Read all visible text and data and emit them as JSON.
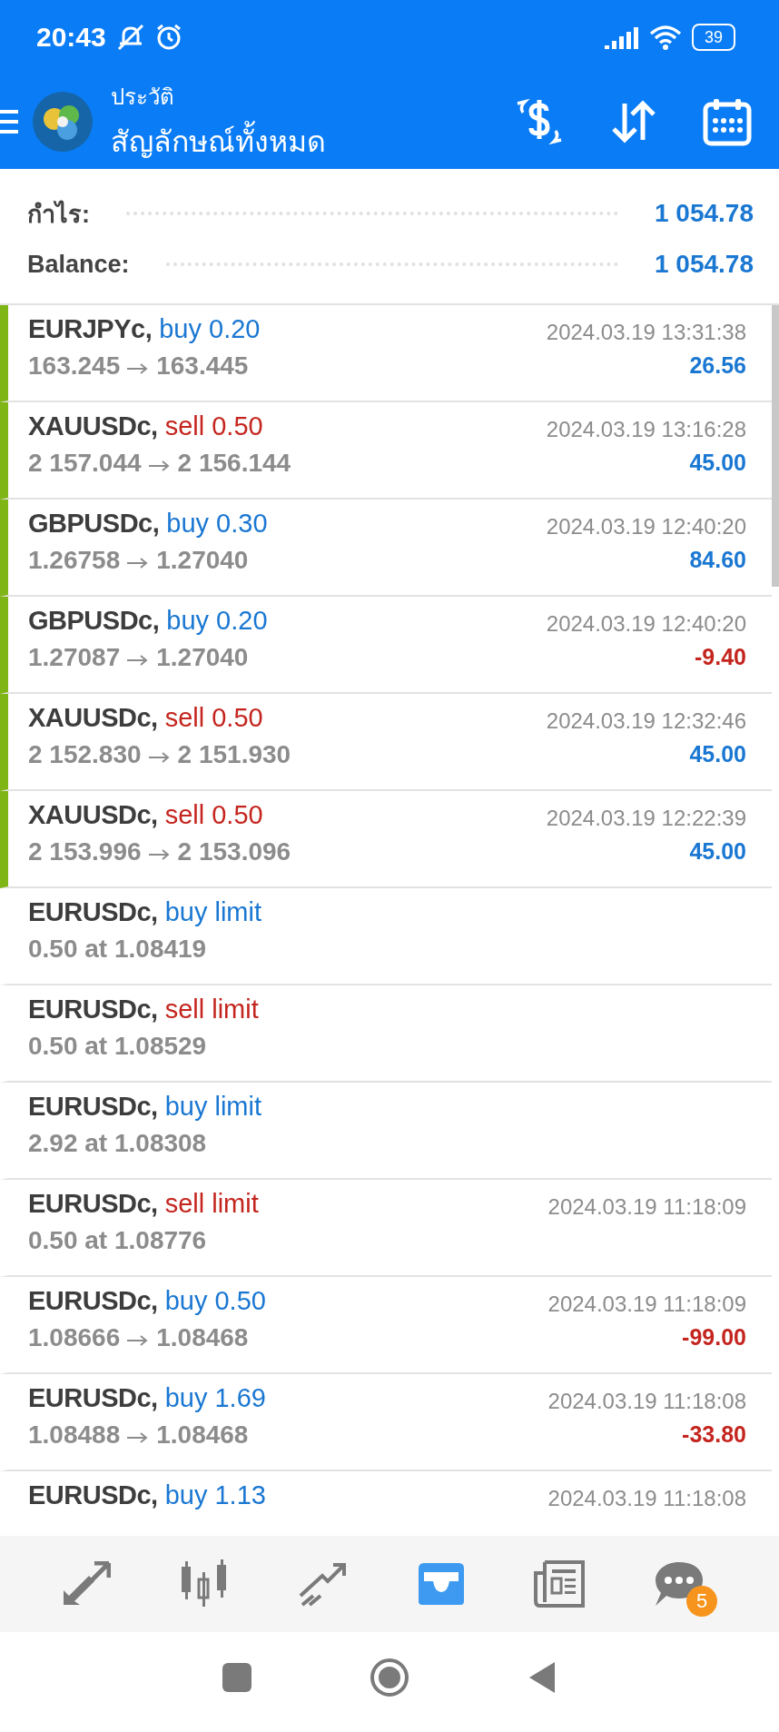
{
  "status_bar": {
    "time": "20:43",
    "battery": "39"
  },
  "header": {
    "subtitle": "ประวัติ",
    "title": "สัญลักษณ์ทั้งหมด"
  },
  "summary": [
    {
      "label": "กำไร:",
      "value": "1 054.78"
    },
    {
      "label": "Balance:",
      "value": "1 054.78"
    }
  ],
  "rows": [
    {
      "kind": "deal",
      "marked": true,
      "symbol": "EURJPYc,",
      "sell": false,
      "action": "buy 0.20",
      "detail_from": "163.245",
      "detail_to": "163.445",
      "time": "2024.03.19 13:31:38",
      "profit": "26.56",
      "loss": false
    },
    {
      "kind": "deal",
      "marked": true,
      "symbol": "XAUUSDc,",
      "sell": true,
      "action": "sell 0.50",
      "detail_from": "2 157.044",
      "detail_to": "2 156.144",
      "time": "2024.03.19 13:16:28",
      "profit": "45.00",
      "loss": false
    },
    {
      "kind": "deal",
      "marked": true,
      "symbol": "GBPUSDc,",
      "sell": false,
      "action": "buy 0.30",
      "detail_from": "1.26758",
      "detail_to": "1.27040",
      "time": "2024.03.19 12:40:20",
      "profit": "84.60",
      "loss": false
    },
    {
      "kind": "deal",
      "marked": true,
      "symbol": "GBPUSDc,",
      "sell": false,
      "action": "buy 0.20",
      "detail_from": "1.27087",
      "detail_to": "1.27040",
      "time": "2024.03.19 12:40:20",
      "profit": "-9.40",
      "loss": true
    },
    {
      "kind": "deal",
      "marked": true,
      "symbol": "XAUUSDc,",
      "sell": true,
      "action": "sell 0.50",
      "detail_from": "2 152.830",
      "detail_to": "2 151.930",
      "time": "2024.03.19 12:32:46",
      "profit": "45.00",
      "loss": false
    },
    {
      "kind": "deal",
      "marked": true,
      "symbol": "XAUUSDc,",
      "sell": true,
      "action": "sell 0.50",
      "detail_from": "2 153.996",
      "detail_to": "2 153.096",
      "time": "2024.03.19 12:22:39",
      "profit": "45.00",
      "loss": false
    },
    {
      "kind": "order",
      "marked": false,
      "symbol": "EURUSDc,",
      "sell": false,
      "action": "buy limit",
      "detail": "0.50 at 1.08419"
    },
    {
      "kind": "order",
      "marked": false,
      "symbol": "EURUSDc,",
      "sell": true,
      "action": "sell limit",
      "detail": "0.50 at 1.08529"
    },
    {
      "kind": "order",
      "marked": false,
      "symbol": "EURUSDc,",
      "sell": false,
      "action": "buy limit",
      "detail": "2.92 at 1.08308"
    },
    {
      "kind": "order",
      "marked": false,
      "symbol": "EURUSDc,",
      "sell": true,
      "action": "sell limit",
      "detail": "0.50 at 1.08776",
      "time": "2024.03.19 11:18:09"
    },
    {
      "kind": "deal",
      "marked": false,
      "symbol": "EURUSDc,",
      "sell": false,
      "action": "buy 0.50",
      "detail_from": "1.08666",
      "detail_to": "1.08468",
      "time": "2024.03.19 11:18:09",
      "profit": "-99.00",
      "loss": true
    },
    {
      "kind": "deal",
      "marked": false,
      "symbol": "EURUSDc,",
      "sell": false,
      "action": "buy 1.69",
      "detail_from": "1.08488",
      "detail_to": "1.08468",
      "time": "2024.03.19 11:18:08",
      "profit": "-33.80",
      "loss": true
    },
    {
      "kind": "head",
      "marked": false,
      "symbol": "EURUSDc,",
      "sell": false,
      "action": "buy 1.13",
      "time": "2024.03.19 11:18:08"
    }
  ],
  "nav": [
    {
      "kind": "quotes",
      "selected": false
    },
    {
      "kind": "chart",
      "selected": false
    },
    {
      "kind": "trade",
      "selected": false
    },
    {
      "kind": "history",
      "selected": true
    },
    {
      "kind": "news",
      "selected": false
    },
    {
      "kind": "chat",
      "selected": false,
      "badge": "5"
    }
  ]
}
